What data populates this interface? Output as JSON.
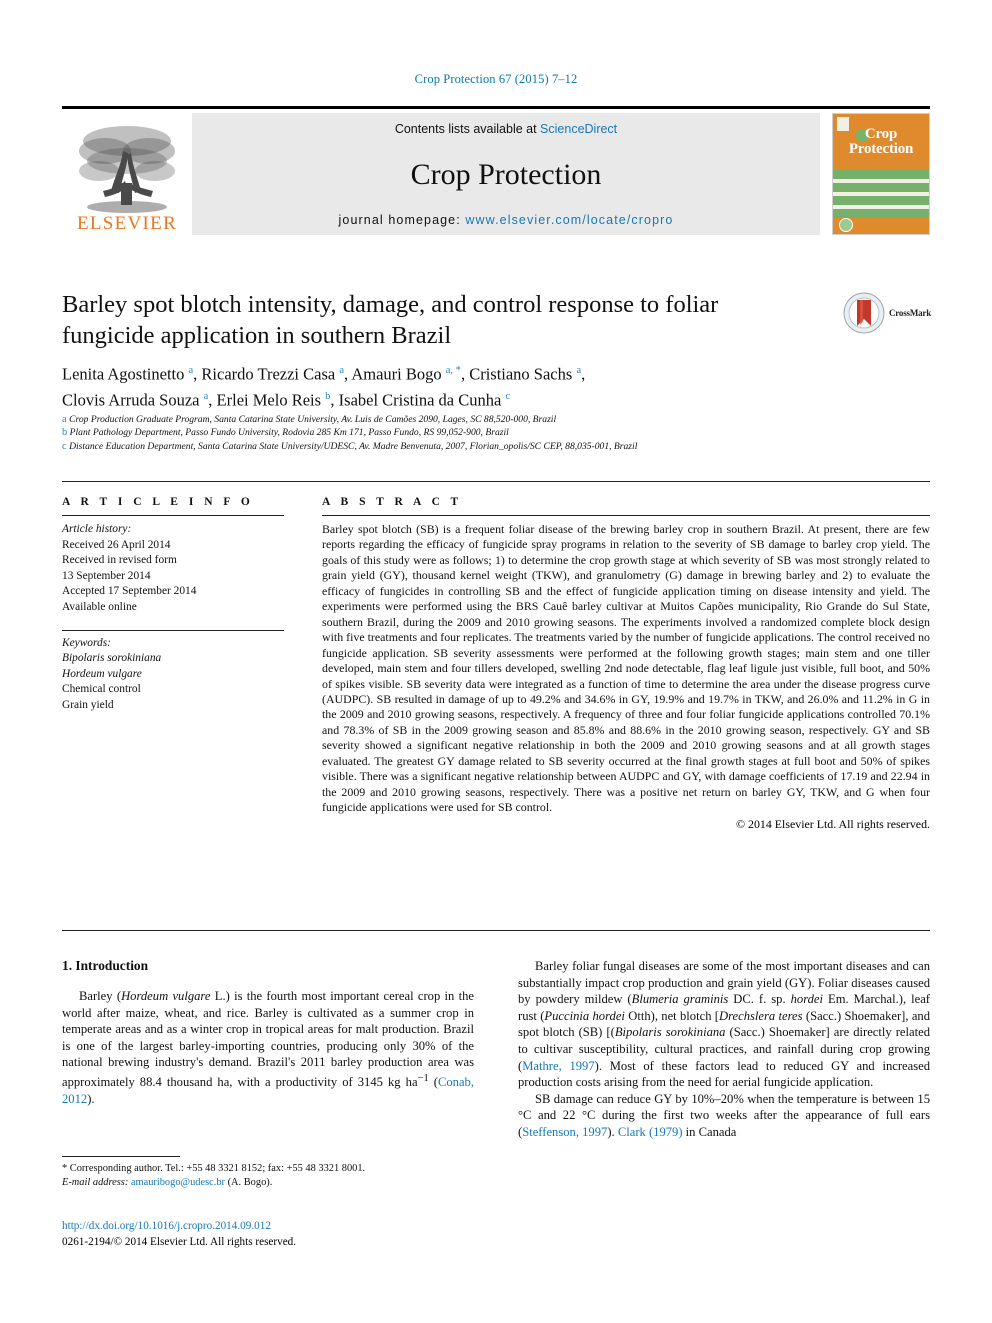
{
  "running_head": "Crop Protection 67 (2015) 7–12",
  "masthead": {
    "publisher": "ELSEVIER",
    "contents_prefix": "Contents lists available at ",
    "contents_link": "ScienceDirect",
    "journal_name": "Crop Protection",
    "homepage_prefix": "journal homepage: ",
    "homepage_url": "www.elsevier.com/locate/cropro",
    "cover_title_line1": "Crop",
    "cover_title_line2": "Protection"
  },
  "article": {
    "title": "Barley spot blotch intensity, damage, and control response to foliar fungicide application in southern Brazil",
    "crossmark_label": "CrossMark",
    "authors_line1": "Lenita Agostinetto <sup>a</sup>, Ricardo Trezzi Casa <sup>a</sup>, Amauri Bogo <sup>a, *</sup>, Cristiano Sachs <sup>a</sup>,",
    "authors_line2": "Clovis Arruda Souza <sup>a</sup>, Erlei Melo Reis <sup>b</sup>, Isabel Cristina da Cunha <sup>c</sup>",
    "affiliations": [
      "Crop Production Graduate Program, Santa Catarina State University, Av. Luis de Camões 2090, Lages, SC 88,520-000, Brazil",
      "Plant Pathology Department, Passo Fundo University, Rodovia 285 Km 171, Passo Fundo, RS 99,052-900, Brazil",
      "Distance Education Department, Santa Catarina State University/UDESC, Av. Madre Benvenuta, 2007, Florian_opolis/SC CEP, 88,035-001, Brazil"
    ],
    "affiliation_marks": [
      "a",
      "b",
      "c"
    ]
  },
  "article_info": {
    "heading": "A R T I C L E  I N F O",
    "history_label": "Article history:",
    "history": [
      "Received 26 April 2014",
      "Received in revised form",
      "13 September 2014",
      "Accepted 17 September 2014",
      "Available online"
    ],
    "keywords_label": "Keywords:",
    "keywords": [
      "Bipolaris sorokiniana",
      "Hordeum vulgare",
      "Chemical control",
      "Grain yield"
    ]
  },
  "abstract": {
    "heading": "A B S T R A C T",
    "text": "Barley spot blotch (SB) is a frequent foliar disease of the brewing barley crop in southern Brazil. At present, there are few reports regarding the efficacy of fungicide spray programs in relation to the severity of SB damage to barley crop yield. The goals of this study were as follows; 1) to determine the crop growth stage at which severity of SB was most strongly related to grain yield (GY), thousand kernel weight (TKW), and granulometry (G) damage in brewing barley and 2) to evaluate the efficacy of fungicides in controlling SB and the effect of fungicide application timing on disease intensity and yield. The experiments were performed using the BRS Cauê barley cultivar at Muitos Capões municipality, Rio Grande do Sul State, southern Brazil, during the 2009 and 2010 growing seasons. The experiments involved a randomized complete block design with five treatments and four replicates. The treatments varied by the number of fungicide applications. The control received no fungicide application. SB severity assessments were performed at the following growth stages; main stem and one tiller developed, main stem and four tillers developed, swelling 2nd node detectable, flag leaf ligule just visible, full boot, and 50% of spikes visible. SB severity data were integrated as a function of time to determine the area under the disease progress curve (AUDPC). SB resulted in damage of up to 49.2% and 34.6% in GY, 19.9% and 19.7% in TKW, and 26.0% and 11.2% in G in the 2009 and 2010 growing seasons, respectively. A frequency of three and four foliar fungicide applications controlled 70.1% and 78.3% of SB in the 2009 growing season and 85.8% and 88.6% in the 2010 growing season, respectively. GY and SB severity showed a significant negative relationship in both the 2009 and 2010 growing seasons and at all growth stages evaluated. The greatest GY damage related to SB severity occurred at the final growth stages at full boot and 50% of spikes visible. There was a significant negative relationship between AUDPC and GY, with damage coefficients of 17.19 and 22.94 in the 2009 and 2010 growing seasons, respectively. There was a positive net return on barley GY, TKW, and G when four fungicide applications were used for SB control.",
    "copyright": "© 2014 Elsevier Ltd. All rights reserved."
  },
  "introduction": {
    "heading": "1. Introduction",
    "left_paragraph": "Barley (<i>Hordeum vulgare</i> L.) is the fourth most important cereal crop in the world after maize, wheat, and rice. Barley is cultivated as a summer crop in temperate areas and as a winter crop in tropical areas for malt production. Brazil is one of the largest barley-importing countries, producing only 30% of the national brewing industry's demand. Brazil's 2011 barley production area was approximately 88.4 thousand ha, with a productivity of 3145 kg ha<sup>−1</sup> (<span class=\"ref\">Conab, 2012</span>).",
    "right_paragraph_1": "Barley foliar fungal diseases are some of the most important diseases and can substantially impact crop production and grain yield (GY). Foliar diseases caused by powdery mildew (<i>Blumeria graminis</i> DC. f. sp. <i>hordei</i> Em. Marchal.), leaf rust (<i>Puccinia hordei</i> Otth), net blotch [<i>Drechslera teres</i> (Sacc.) Shoemaker], and spot blotch (SB) [(<i>Bipolaris sorokiniana</i> (Sacc.) Shoemaker] are directly related to cultivar susceptibility, cultural practices, and rainfall during crop growing (<span class=\"ref\">Mathre, 1997</span>). Most of these factors lead to reduced GY and increased production costs arising from the need for aerial fungicide application.",
    "right_paragraph_2": "SB damage can reduce GY by 10%–20% when the temperature is between 15 °C and 22 °C during the first two weeks after the appearance of full ears (<span class=\"ref\">Steffenson, 1997</span>). <span class=\"ref\">Clark (1979)</span> in Canada"
  },
  "footnotes": {
    "corresponding": "* Corresponding author. Tel.: +55 48 3321 8152; fax: +55 48 3321 8001.",
    "email_label": "E-mail address:",
    "email": "amauribogo@udesc.br",
    "email_suffix": " (A. Bogo).",
    "doi_url": "http://dx.doi.org/10.1016/j.cropro.2014.09.012",
    "issn_copyright": "0261-2194/© 2014 Elsevier Ltd. All rights reserved."
  },
  "colors": {
    "link": "#1878b5",
    "running_head": "#0b7aa5",
    "elsevier_orange": "#e87722",
    "cover_orange": "#e08a2e",
    "cover_green": "#76b16b"
  }
}
